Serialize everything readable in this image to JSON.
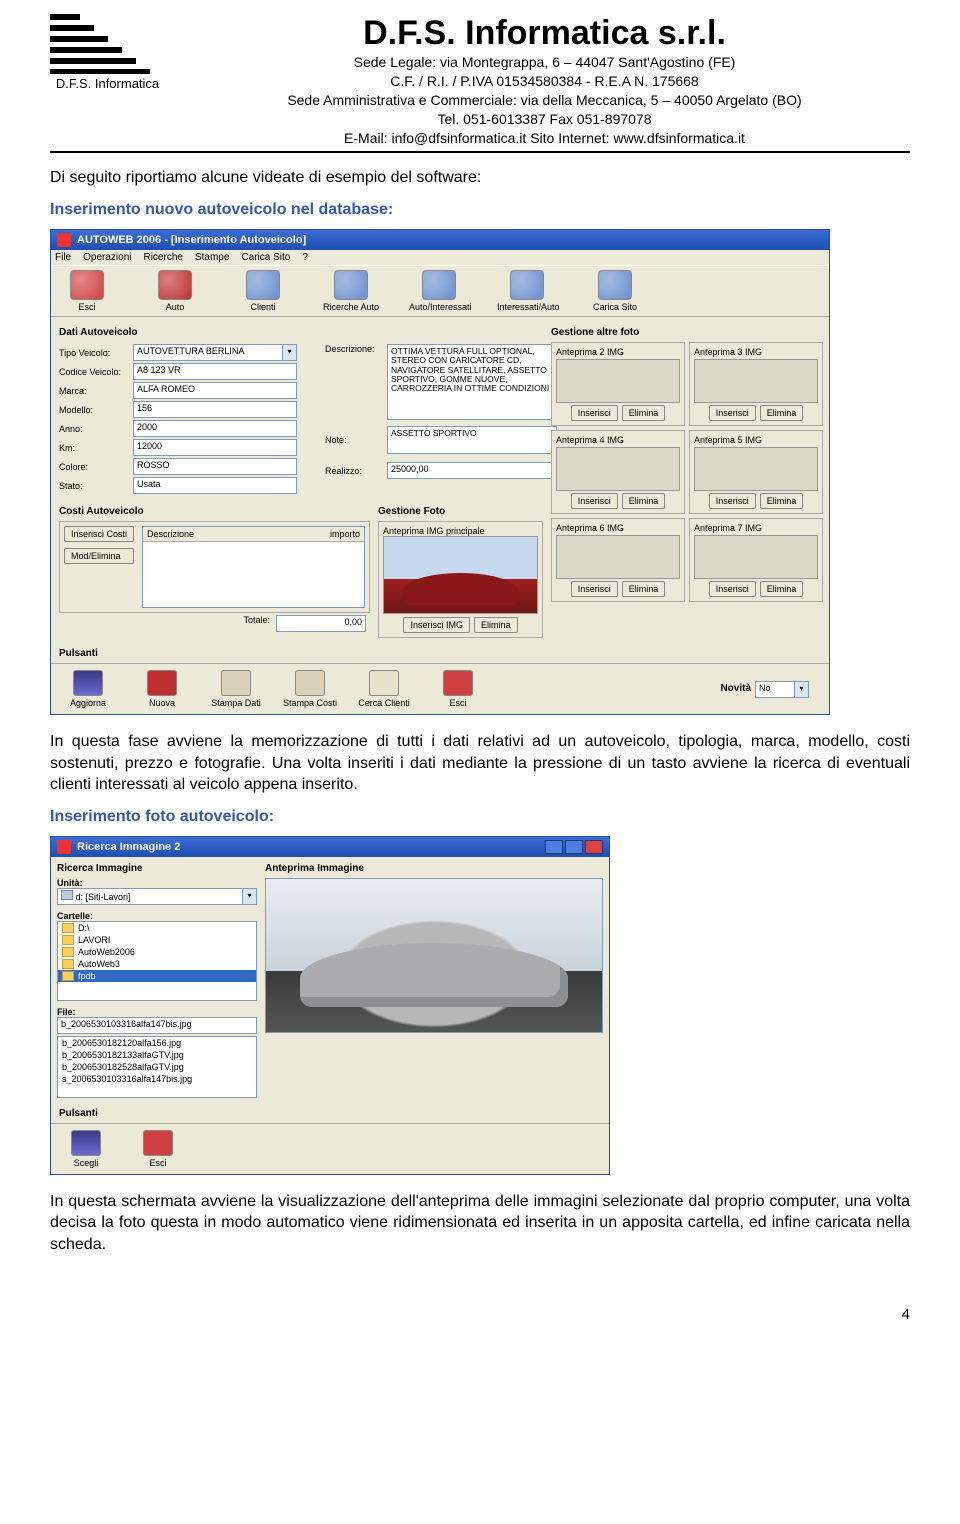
{
  "letterhead": {
    "logo_caption": "D.F.S. Informatica",
    "company_name": "D.F.S. Informatica s.r.l.",
    "line1": "Sede Legale: via Montegrappa, 6 – 44047 Sant'Agostino (FE)",
    "line2": "C.F. / R.I. / P.IVA 01534580384 - R.E.A N. 175668",
    "line3": "Sede Amministrativa e Commerciale: via della Meccanica, 5 – 40050 Argelato (BO)",
    "line4": "Tel. 051-6013387 Fax 051-897078",
    "line5": "E-Mail: info@dfsinformatica.it  Sito Internet: www.dfsinformatica.it"
  },
  "doc": {
    "intro": "Di seguito riportiamo alcune videate di esempio del software:",
    "section1_title": "Inserimento nuovo autoveicolo nel database:",
    "para1": "In questa fase avviene la memorizzazione di tutti i dati relativi ad un autoveicolo, tipologia, marca, modello, costi sostenuti, prezzo e fotografie. Una volta inseriti i dati mediante la pressione di un tasto avviene la ricerca di eventuali clienti interessati al veicolo appena inserito.",
    "section2_title": "Inserimento foto autoveicolo:",
    "para2": "In questa schermata avviene la visualizzazione dell'anteprima delle immagini selezionate dal proprio computer, una volta decisa la foto questa in modo automatico viene ridimensionata ed inserita in un apposita cartella, ed infine caricata nella scheda.",
    "page_number": "4"
  },
  "ss1": {
    "title": "AUTOWEB 2006 - [Inserimento Autoveicolo]",
    "menu": [
      "File",
      "Operazioni",
      "Ricerche",
      "Stampe",
      "Carica Sito",
      "?"
    ],
    "toolbar": [
      {
        "label": "Esci"
      },
      {
        "label": "Auto"
      },
      {
        "label": "Clienti"
      },
      {
        "label": "Ricerche Auto"
      },
      {
        "label": "Auto/Interessati"
      },
      {
        "label": "Interessati/Auto"
      },
      {
        "label": "Carica Sito"
      }
    ],
    "group_dati": "Dati Autoveicolo",
    "fields": {
      "tipo_label": "Tipo Veicolo:",
      "tipo_value": "AUTOVETTURA BERLINA",
      "codice_label": "Codice Veicolo:",
      "codice_value": "A8 123 VR",
      "marca_label": "Marca:",
      "marca_value": "ALFA ROMEO",
      "modello_label": "Modello:",
      "modello_value": "156",
      "anno_label": "Anno:",
      "anno_value": "2000",
      "km_label": "Km:",
      "km_value": "12000",
      "colore_label": "Colore:",
      "colore_value": "ROSSO",
      "stato_label": "Stato:",
      "stato_value": "Usata",
      "descr_label": "Descrizione:",
      "descr_value": "OTTIMA VETTURA FULL OPTIONAL, STEREO CON CARICATORE CD, NAVIGATORE SATELLITARE, ASSETTO SPORTIVO, GOMME NUOVE, CARROZZERIA IN OTTIME CONDIZIONI",
      "note_label": "Note:",
      "note_value": "ASSETTO SPORTIVO",
      "realizzo_label": "Realizzo:",
      "realizzo_value": "25000,00"
    },
    "group_costi": "Costi Autoveicolo",
    "costi_btn1": "Inserisci Costi",
    "costi_btn2": "Mod/Elimina",
    "costi_cols": [
      "Descrizione",
      "importo"
    ],
    "totale_label": "Totale:",
    "totale_value": "0,00",
    "group_altre": "Gestione altre foto",
    "thumbs": [
      "Anteprima 2 IMG",
      "Anteprima 3 IMG",
      "Anteprima 4 IMG",
      "Anteprima 5 IMG",
      "Anteprima 6 IMG",
      "Anteprima 7 IMG"
    ],
    "thumb_btn1": "Inserisci",
    "thumb_btn2": "Elimina",
    "group_foto": "Gestione Foto",
    "foto_caption": "Anteprima IMG principale",
    "foto_btn1": "Inserisci IMG",
    "foto_btn2": "Elimina",
    "group_pulsanti": "Pulsanti",
    "pulsanti": [
      "Aggiorna",
      "Nuova",
      "Stampa Dati",
      "Stampa Costi",
      "Cerca Clienti",
      "Esci"
    ],
    "novita_label": "Novità",
    "novita_value": "No"
  },
  "ss2": {
    "title": "Ricerca Immagine 2",
    "left_title": "Ricerca Immagine",
    "unita_label": "Unità:",
    "unita_value": "d: [Siti-Lavori]",
    "cartelle_label": "Cartelle:",
    "folders": [
      "D:\\",
      "LAVORI",
      "AutoWeb2006",
      "AutoWeb3",
      "fpdb"
    ],
    "folder_selected_index": 4,
    "file_label": "File:",
    "file_selected": "b_2006530103316alfa147bis.jpg",
    "files": [
      "b_2006530182120alfa156.jpg",
      "b_2006530182133alfaGTV.jpg",
      "b_2006530182528alfaGTV.jpg",
      "s_2006530103316alfa147bis.jpg"
    ],
    "right_title": "Anteprima Immagine",
    "pulsanti_label": "Pulsanti",
    "btns": [
      "Scegli",
      "Esci"
    ]
  }
}
